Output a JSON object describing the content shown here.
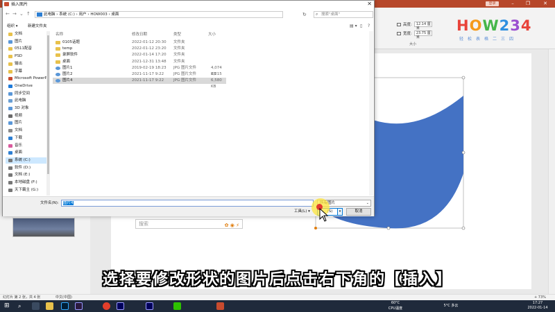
{
  "dialog": {
    "title": "插入图片",
    "close_glyph": "✕",
    "address_path": "此电脑 › 系统 (C:) › 用户 › HOW003 › 桌面",
    "search_placeholder": "搜索\"桌面\"",
    "toolbar": {
      "organize": "组织 ▾",
      "new_folder": "新建文件夹"
    },
    "columns": {
      "name": "名称",
      "date": "修改日期",
      "type": "类型",
      "size": "大小"
    },
    "nav_items": [
      "文档",
      "图片",
      "0511配音",
      "PSD",
      "输出",
      "字幕",
      "Microsoft PowerPoint",
      "OneDrive",
      "同步空间",
      "此电脑",
      "3D 对象",
      "视频",
      "图片",
      "文档",
      "下载",
      "音乐",
      "桌面",
      "系统 (C:)",
      "软件 (D:)",
      "文档 (E:)",
      "本地磁盘 (F:)",
      "天下霸主 (G:)"
    ],
    "files": [
      {
        "name": "0105话题",
        "date": "2022-01-12 20:30",
        "type": "文件夹",
        "size": "",
        "kind": "folder"
      },
      {
        "name": "temp",
        "date": "2022-01-12 23:20",
        "type": "文件夹",
        "size": "",
        "kind": "folder"
      },
      {
        "name": "录屏软件",
        "date": "2022-01-14 17:20",
        "type": "文件夹",
        "size": "",
        "kind": "folder"
      },
      {
        "name": "桌面",
        "date": "2021-12-31 13:48",
        "type": "文件夹",
        "size": "",
        "kind": "folder"
      },
      {
        "name": "图片1",
        "date": "2019-02-19 18:23",
        "type": "JPG 图片文件",
        "size": "4,074 KB",
        "kind": "image"
      },
      {
        "name": "图片2",
        "date": "2021-11-17 9:22",
        "type": "JPG 图片文件",
        "size": "2,215 KB",
        "kind": "image"
      },
      {
        "name": "图片4",
        "date": "2021-11-17 9:22",
        "type": "JPG 图片文件",
        "size": "6,580 KB",
        "kind": "image"
      }
    ],
    "filename_label": "文件名(N):",
    "filename_value": "图片4",
    "filter_value": "所有图片",
    "tools_label": "工具(L) ▾",
    "insert_label": "(S)",
    "cancel_label": "取消"
  },
  "ppt": {
    "login_label": "登录",
    "width_value": "12.14 厘米",
    "height_value": "23.75 厘米",
    "size_group_label": "大小",
    "logo_text": "HOW234",
    "logo_sub": "轻松表格二三四",
    "search_placeholder": "搜索",
    "status_left": "幻灯片 第 2 张，共 4 张",
    "status_lang": "中文(中国)",
    "status_zoom": "+ 73%"
  },
  "subtitle": "选择要修改形状的图片后点击右下角的【插入】",
  "taskbar": {
    "temp": "60°C",
    "cpu": "CPU温度",
    "weather": "5°C 多云",
    "time": "17:27",
    "date": "2022-01-14"
  },
  "colors": {
    "ppt_accent": "#b7472a",
    "shape_blue": "#4472c4",
    "selection_blue": "#0078d7"
  }
}
